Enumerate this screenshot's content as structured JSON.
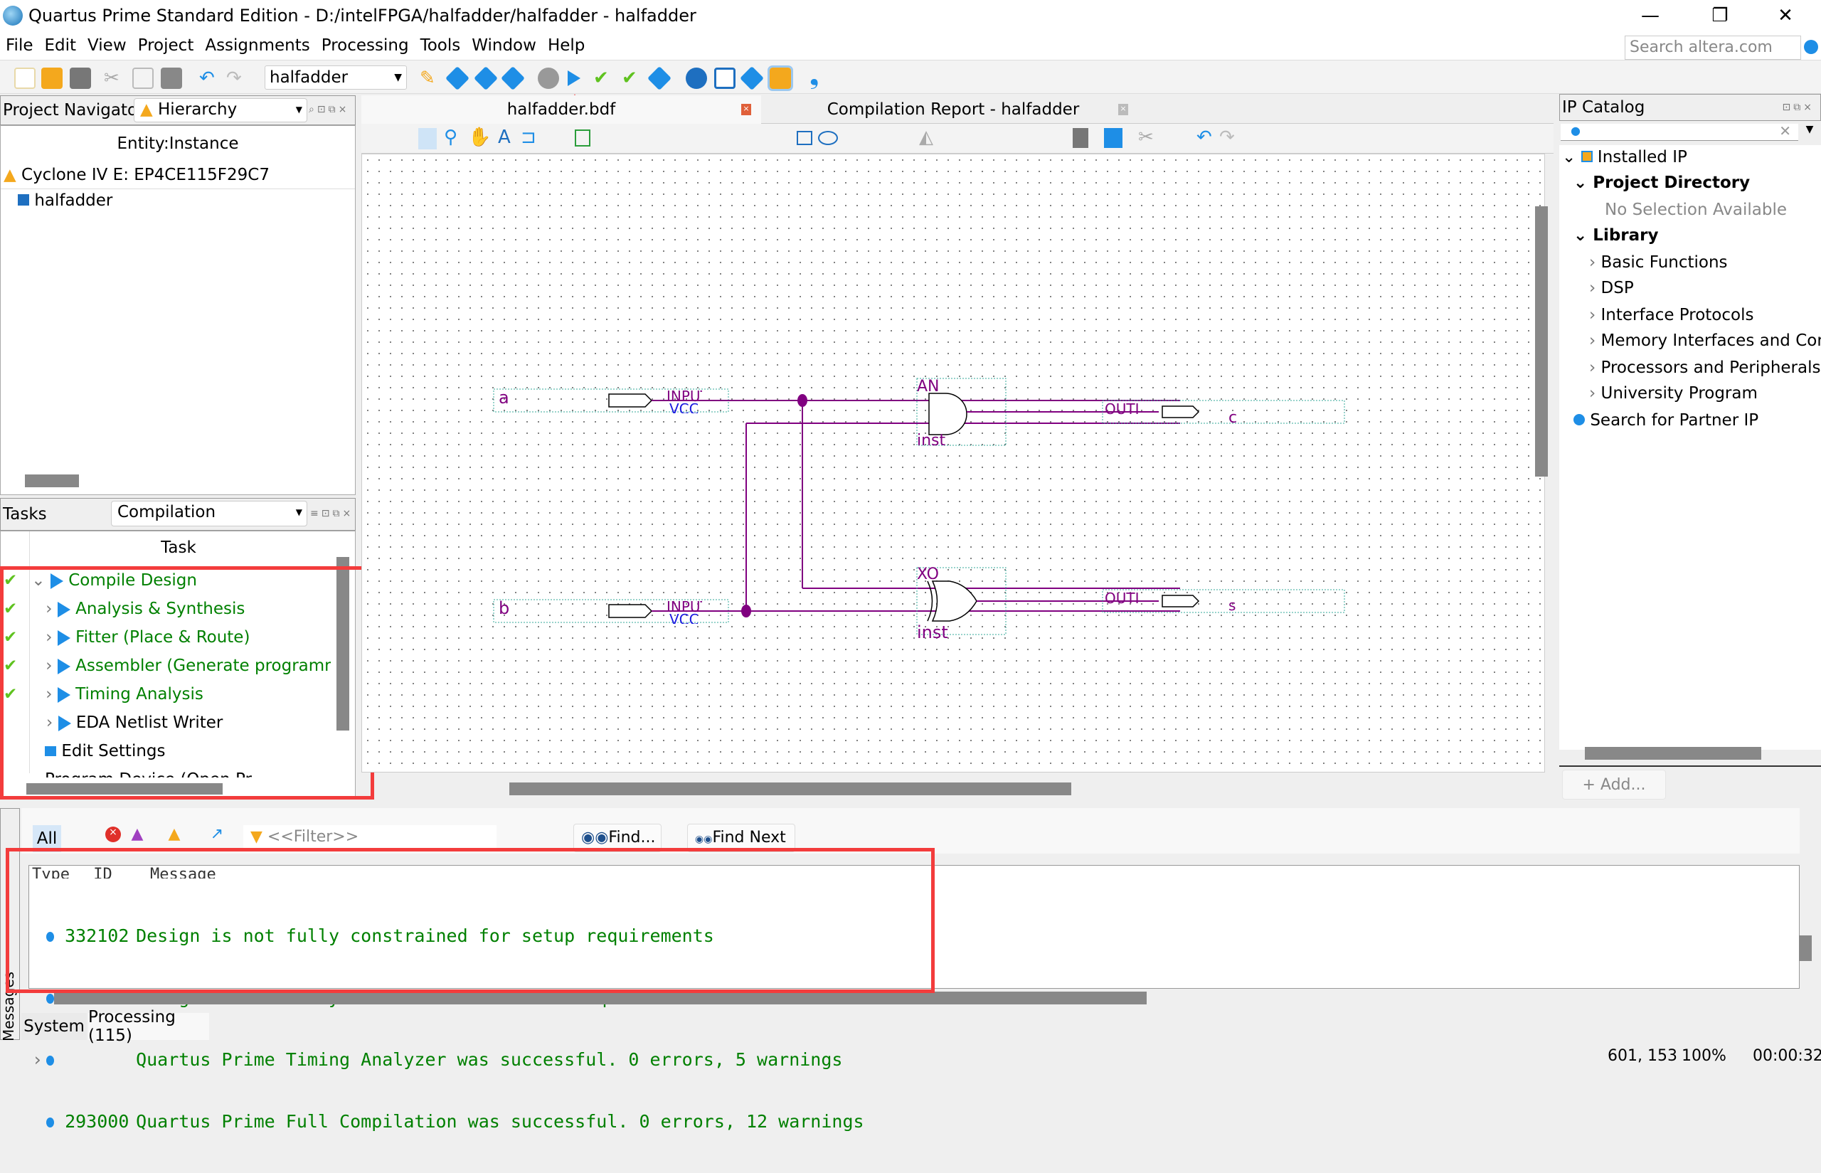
{
  "window": {
    "title": "Quartus Prime Standard Edition - D:/intelFPGA/halfadder/halfadder - halfadder",
    "minimize": "—",
    "restore": "❐",
    "close": "✕"
  },
  "menu": [
    "File",
    "Edit",
    "View",
    "Project",
    "Assignments",
    "Processing",
    "Tools",
    "Window",
    "Help"
  ],
  "search": {
    "placeholder": "Search altera.com"
  },
  "toolbar": {
    "project_select": "halfadder"
  },
  "project_navigator": {
    "title": "Project Navigator",
    "view": "Hierarchy",
    "column": "Entity:Instance",
    "device": "Cyclone IV E: EP4CE115F29C7",
    "entity": "halfadder"
  },
  "tasks": {
    "title": "Tasks",
    "flow": "Compilation",
    "column": "Task",
    "items": [
      {
        "label": "Compile Design",
        "done": true
      },
      {
        "label": "Analysis & Synthesis",
        "done": true
      },
      {
        "label": "Fitter (Place & Route)",
        "done": true
      },
      {
        "label": "Assembler (Generate programm",
        "done": true
      },
      {
        "label": "Timing Analysis",
        "done": true
      },
      {
        "label": "EDA Netlist Writer",
        "done": false
      },
      {
        "label": "Edit Settings",
        "done": false
      },
      {
        "label": "Program Device (Open Pr",
        "done": false
      }
    ]
  },
  "editor": {
    "tabs": [
      {
        "label": "halfadder.bdf",
        "active": true
      },
      {
        "label": "Compilation Report - halfadder",
        "active": false
      }
    ],
    "schematic": {
      "inputs": [
        {
          "name": "a",
          "type": "INPUT",
          "vcc": "VCC"
        },
        {
          "name": "b",
          "type": "INPUT",
          "vcc": "VCC"
        }
      ],
      "gates": [
        {
          "type": "AND2",
          "label": "AN",
          "inst": "inst"
        },
        {
          "type": "XOR",
          "label": "XO",
          "inst": "inst"
        }
      ],
      "outputs": [
        {
          "name": "c",
          "type": "OUTPUT",
          "label": "OUTI"
        },
        {
          "name": "s",
          "type": "OUTPUT",
          "label": "OUTI"
        }
      ]
    }
  },
  "ip_catalog": {
    "title": "IP Catalog",
    "installed": "Installed IP",
    "project_dir": "Project Directory",
    "no_selection": "No Selection Available",
    "library": "Library",
    "library_items": [
      "Basic Functions",
      "DSP",
      "Interface Protocols",
      "Memory Interfaces and Cont",
      "Processors and Peripherals",
      "University Program"
    ],
    "partner": "Search for Partner IP",
    "add": "+  Add..."
  },
  "messages": {
    "filter_all": "All",
    "filter_placeholder": "<<Filter>>",
    "find": "Find...",
    "find_next": "Find Next",
    "columns": [
      "Type",
      "ID",
      "Message"
    ],
    "rows": [
      {
        "id": "332102",
        "text": "Design is not fully constrained for setup requirements",
        "expand": false
      },
      {
        "id": "332102",
        "text": "Design is not fully constrained for hold requirements",
        "expand": false
      },
      {
        "id": "",
        "text": "Quartus Prime Timing Analyzer was successful. 0 errors, 5 warnings",
        "expand": true
      },
      {
        "id": "293000",
        "text": "Quartus Prime Full Compilation was successful. 0 errors, 12 warnings",
        "expand": false
      }
    ],
    "side_label": "Messages",
    "tabs": [
      "System",
      "Processing (115)"
    ]
  },
  "status": {
    "coords": "601, 153",
    "zoom": "100%",
    "time": "00:00:32"
  }
}
